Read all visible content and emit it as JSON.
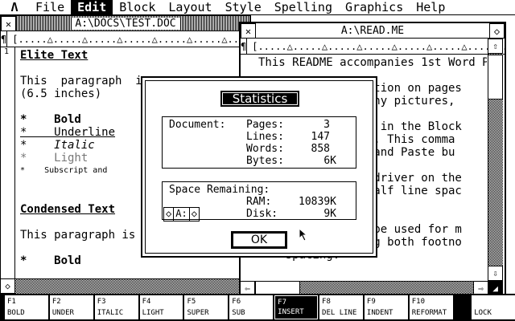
{
  "menubar": {
    "logo": "Λ",
    "items": [
      "File",
      "Edit",
      "Block",
      "Layout",
      "Style",
      "Spelling",
      "Graphics",
      "Help"
    ],
    "active": "Edit"
  },
  "back_window": {
    "title": "A:\\DOCS\\TEST.DOC",
    "pilcrow": "¶",
    "ruler": "[.....△.....△.....△.....△.....△.....△.....△.....△.....△.....",
    "line_num": "1",
    "lines": [
      {
        "text": "Elite Text",
        "style": "bu"
      },
      {
        "text": "",
        "style": ""
      },
      {
        "text": "This  paragraph  is",
        "style": ""
      },
      {
        "text": "(6.5 inches)",
        "style": ""
      },
      {
        "text": "",
        "style": ""
      },
      {
        "text": "*    Bold",
        "style": "b"
      },
      {
        "text": "*    Underline",
        "style": "u"
      },
      {
        "text": "*    Italic",
        "style": "i"
      },
      {
        "text": "*    Light",
        "style": "light"
      },
      {
        "text": "*    Subscript and",
        "style": "small"
      },
      {
        "text": "",
        "style": ""
      },
      {
        "text": "",
        "style": ""
      },
      {
        "text": "Condensed Text",
        "style": "bu"
      },
      {
        "text": "",
        "style": ""
      },
      {
        "text": "This paragraph is p",
        "style": ""
      },
      {
        "text": "",
        "style": ""
      },
      {
        "text": "*    Bold",
        "style": "b"
      }
    ]
  },
  "front_window": {
    "title": "A:\\READ.ME",
    "pilcrow": "¶",
    "ruler": "[.....△.....△.....△.....△.....△.....△.....△....",
    "lines": [
      "This README accompanies 1st Word Pl",
      "",
      "             ormation on pages",
      "             es any pictures,",
      "",
      "             lity in the Block",
      "             text. This comma",
      "             Cut and Paste bu",
      "",
      "             ter driver on the",
      "             -a-half line spac",
      "             ng.",
      "",
      "             not be used for m",
      "             ining both footno",
      "    spacing."
    ]
  },
  "dialog": {
    "title": "Statistics",
    "document_label": "Document:",
    "pages_label": "Pages:",
    "pages": "3",
    "lines_label": "Lines:",
    "lines": "147",
    "words_label": "Words:",
    "words": "858",
    "bytes_label": "Bytes:",
    "bytes": "6K",
    "space_label": "Space Remaining:",
    "ram_label": "RAM:",
    "ram": "10839K",
    "disk_label": "Disk:",
    "disk": "9K",
    "drive": "A:",
    "ok": "OK"
  },
  "fkeys": [
    {
      "num": "F1",
      "label": "BOLD"
    },
    {
      "num": "F2",
      "label": "UNDER"
    },
    {
      "num": "F3",
      "label": "ITALIC"
    },
    {
      "num": "F4",
      "label": "LIGHT"
    },
    {
      "num": "F5",
      "label": "SUPER"
    },
    {
      "num": "F6",
      "label": "SUB"
    },
    {
      "num": "F7",
      "label": "INSERT",
      "active": true
    },
    {
      "num": "F8",
      "label": "DEL LINE"
    },
    {
      "num": "F9",
      "label": "INDENT"
    },
    {
      "num": "F10",
      "label": "REFORMAT"
    },
    {
      "num": "",
      "label": ""
    },
    {
      "num": "",
      "label": "LOCK"
    }
  ],
  "icons": {
    "close": "close-box-icon",
    "full": "fuller-icon",
    "up": "up-arrow-icon",
    "down": "down-arrow-icon",
    "left": "left-arrow-icon",
    "right": "right-arrow-icon",
    "size": "sizer-icon"
  }
}
